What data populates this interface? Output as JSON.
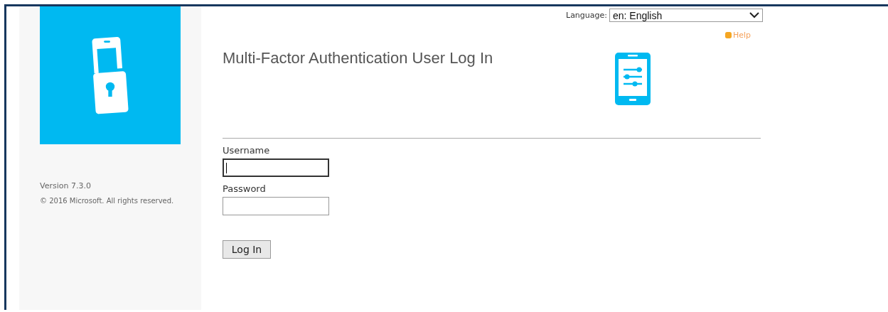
{
  "sidebar": {
    "version": "Version 7.3.0",
    "copyright": "© 2016 Microsoft. All rights reserved."
  },
  "language": {
    "label": "Language:",
    "value": "en: English"
  },
  "help": {
    "label": "Help"
  },
  "title": "Multi-Factor Authentication User Log In",
  "form": {
    "fields": [
      {
        "label": "Username",
        "focused": true
      },
      {
        "label": "Password",
        "focused": false
      }
    ],
    "button": "Log In"
  }
}
